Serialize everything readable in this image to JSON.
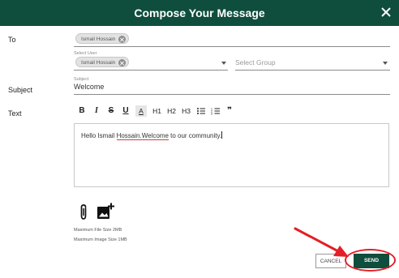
{
  "header": {
    "title": "Compose Your Message",
    "close_icon": "close-icon"
  },
  "to": {
    "label": "To",
    "chip": "Ismail Hossain",
    "select_user_label": "Select User",
    "select_user_chip": "Ismail Hossain",
    "select_group_placeholder": "Select Group"
  },
  "subject": {
    "label": "Subject",
    "small_label": "Subject",
    "value": "Welcome"
  },
  "text": {
    "label": "Text",
    "toolbar": {
      "bold": "B",
      "italic": "I",
      "strike": "S",
      "underline": "U",
      "highlight": "A",
      "h1": "H1",
      "h2": "H2",
      "h3": "H3",
      "bullet_list_icon": "bullet-list-icon",
      "numbered_list_icon": "numbered-list-icon",
      "quote": "❞"
    },
    "editor": {
      "before": "Hello Ismail ",
      "misspelled": "Hossain.Welcome",
      "after": " to our community."
    }
  },
  "attachments": {
    "attach_icon": "paperclip-icon",
    "image_icon": "add-image-icon",
    "max_file": "Maximum File Size 2MB",
    "max_image": "Maximum Image Size 1MB"
  },
  "actions": {
    "cancel": "CANCEL",
    "send": "SEND"
  },
  "colors": {
    "brand": "#0f4d3c",
    "annotation": "#e41e26"
  }
}
